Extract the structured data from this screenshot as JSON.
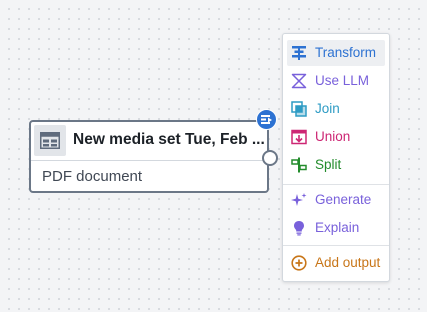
{
  "node": {
    "title": "New media set Tue, Feb ...",
    "subtitle": "PDF document"
  },
  "menu": {
    "items": [
      {
        "label": "Transform",
        "icon": "transform-icon",
        "color": "#2d72d2"
      },
      {
        "label": "Use LLM",
        "icon": "llm-icon",
        "color": "#7961db"
      },
      {
        "label": "Join",
        "icon": "join-icon",
        "color": "#2d9bc4"
      },
      {
        "label": "Union",
        "icon": "union-icon",
        "color": "#cd2674"
      },
      {
        "label": "Split",
        "icon": "split-icon",
        "color": "#238c2c"
      },
      {
        "label": "Generate",
        "icon": "sparkle-icon",
        "color": "#7961db"
      },
      {
        "label": "Explain",
        "icon": "lightbulb-icon",
        "color": "#7961db"
      },
      {
        "label": "Add output",
        "icon": "add-circle-icon",
        "color": "#c87619"
      }
    ]
  },
  "colors": {
    "node_border": "#6b7787",
    "badge": "#2d72d2"
  }
}
